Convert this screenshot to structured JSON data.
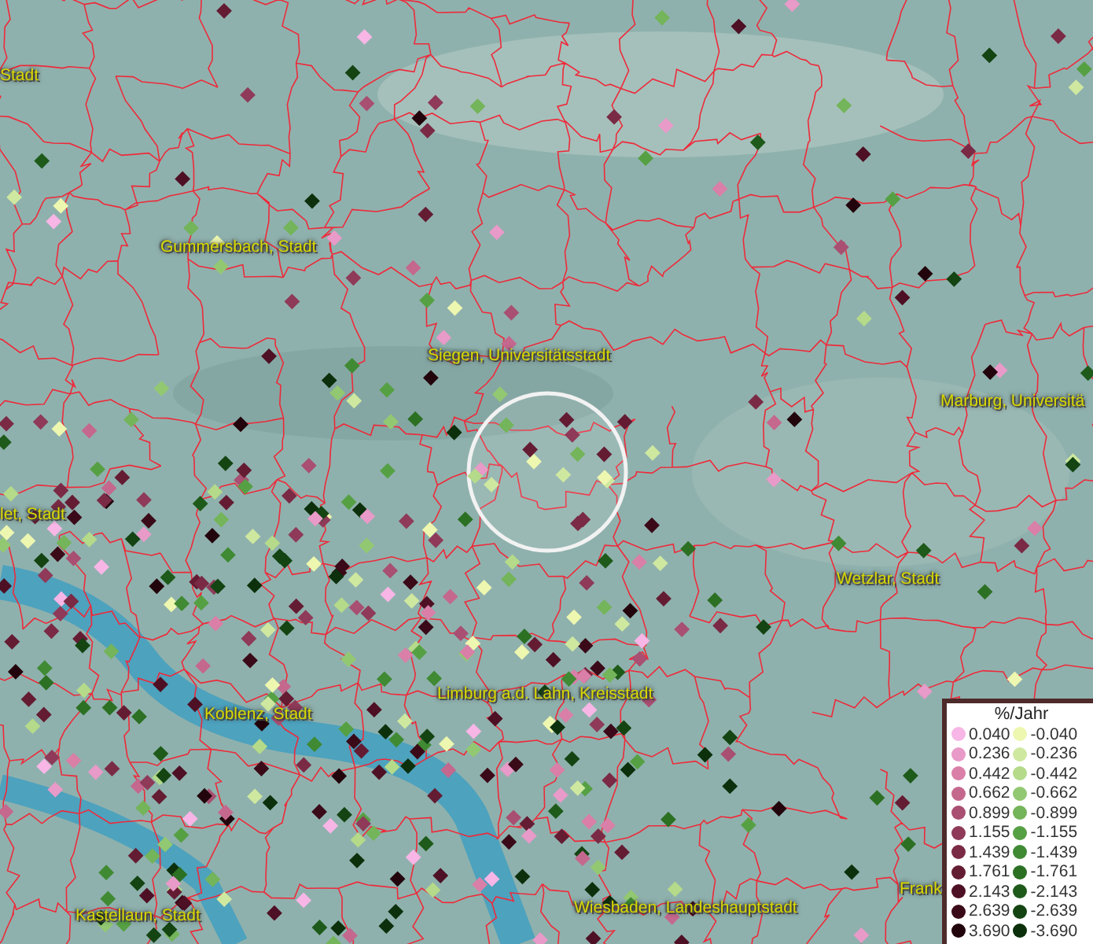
{
  "map": {
    "places": [
      {
        "label": "Stadt"
      },
      {
        "label": "Gummersbach, Stadt"
      },
      {
        "label": "Siegen, Universitätsstadt"
      },
      {
        "label": "Marburg, Universitä"
      },
      {
        "label": "let, Stadt"
      },
      {
        "label": "Wetzlar, Stadt"
      },
      {
        "label": "Limburg a.d. Lahn, Kreisstadt"
      },
      {
        "label": "Koblenz, Stadt"
      },
      {
        "label": "Kastellaun, Stadt"
      },
      {
        "label": "Wiesbaden, Landeshauptstadt"
      },
      {
        "label": "Frank"
      }
    ]
  },
  "legend": {
    "title": "%/Jahr",
    "columns": [
      {
        "items": [
          {
            "label": "0.040",
            "color": "#f7b6e6"
          },
          {
            "label": "0.236",
            "color": "#e89ac8"
          },
          {
            "label": "0.442",
            "color": "#d97fa8"
          },
          {
            "label": "0.662",
            "color": "#c4688e"
          },
          {
            "label": "0.899",
            "color": "#a84f72"
          },
          {
            "label": "1.155",
            "color": "#8e3a58"
          },
          {
            "label": "1.439",
            "color": "#7a2a45"
          },
          {
            "label": "1.761",
            "color": "#641c33"
          },
          {
            "label": "2.143",
            "color": "#4e1024"
          },
          {
            "label": "2.639",
            "color": "#3a0a18"
          },
          {
            "label": "3.690",
            "color": "#22050c"
          }
        ]
      },
      {
        "items": [
          {
            "label": "-0.040",
            "color": "#eef7b0"
          },
          {
            "label": "-0.236",
            "color": "#cfe8a0"
          },
          {
            "label": "-0.442",
            "color": "#b4da8a"
          },
          {
            "label": "-0.662",
            "color": "#93c872"
          },
          {
            "label": "-0.899",
            "color": "#74b45a"
          },
          {
            "label": "-1.155",
            "color": "#56a044"
          },
          {
            "label": "-1.439",
            "color": "#3f8a33"
          },
          {
            "label": "-1.761",
            "color": "#2c7024"
          },
          {
            "label": "-2.143",
            "color": "#1e5a1a"
          },
          {
            "label": "-2.639",
            "color": "#134412"
          },
          {
            "label": "-3.690",
            "color": "#0b300b"
          }
        ]
      }
    ]
  }
}
